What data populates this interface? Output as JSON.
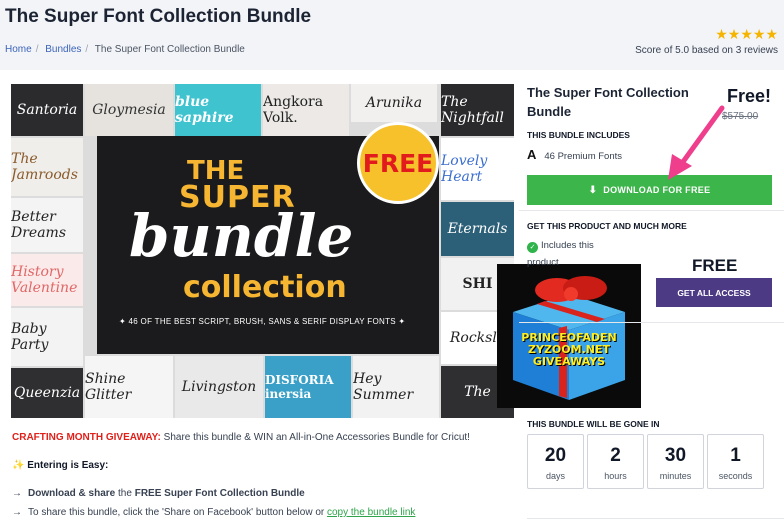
{
  "page": {
    "title": "The Super Font Collection Bundle",
    "breadcrumbs": [
      "Home",
      "Bundles",
      "The Super Font Collection Bundle"
    ],
    "rating": {
      "stars": 5,
      "score_text": "Score of 5.0 based on 3 reviews"
    }
  },
  "hero": {
    "free_badge": "FREE",
    "line_the": "THE",
    "line_super": "SUPER",
    "line_bundle": "bundle",
    "line_collection": "collection",
    "subtitle": "✦ 46 OF THE BEST SCRIPT, BRUSH, SANS & SERIF DISPLAY FONTS ✦",
    "tiles": [
      "Santoria",
      "Gloymesia",
      "blue saphire",
      "Angkora Volk.",
      "Arunika",
      "The Nightfall",
      "The Jamroods",
      "Lovely Heart",
      "Better Dreams",
      "Eternals",
      "History Valentine",
      "SHI",
      "Baby Party",
      "Rocksle",
      "Queenzia",
      "Shine Glitter",
      "Livingston",
      "DISFORIA inersia",
      "Hey Summer",
      "The"
    ],
    "overlay_text": [
      "PRINCEOFADEN",
      "ZYZOOM.NET",
      "GIVEAWAYS"
    ]
  },
  "body": {
    "promo_label": "CRAFTING MONTH GIVEAWAY:",
    "promo_text": " Share this bundle & WIN an All-in-One Accessories Bundle for Cricut!",
    "easy_label": "Entering is Easy:",
    "step1_bold": "Download & share",
    "step1_mid": " the ",
    "step1_bold2": "FREE Super Font Collection Bundle",
    "step2_text": "To share this bundle, click the 'Share on Facebook' button below or ",
    "step2_link": "copy the bundle link"
  },
  "sidebar": {
    "title": "The Super Font Collection Bundle",
    "price_label": "Free!",
    "old_price": "$575.00",
    "includes_heading": "THIS BUNDLE INCLUDES",
    "font_glyph": "A",
    "fonts_count_text": "46 Premium Fonts",
    "download_button": "DOWNLOAD FOR FREE",
    "more_heading": "GET THIS PRODUCT AND MUCH MORE",
    "includes_this": "Includes this",
    "product_text": "product",
    "free_big": "FREE",
    "access_button": "GET ALL ACCESS",
    "gone_heading": "THIS BUNDLE WILL BE GONE IN",
    "countdown": [
      {
        "value": "20",
        "unit": "days"
      },
      {
        "value": "2",
        "unit": "hours"
      },
      {
        "value": "30",
        "unit": "minutes"
      },
      {
        "value": "1",
        "unit": "seconds"
      }
    ]
  },
  "colors": {
    "download_green": "#3cb54a",
    "access_purple": "#4d3a84",
    "promo_red": "#e0211b",
    "badge_yellow": "#f6c12b",
    "arrow_pink": "#ee3e8c"
  },
  "icons": {
    "download": "download-icon",
    "check": "check-circle-icon",
    "rating": "star-icon",
    "step": "arrow-right-icon",
    "sparkle": "sparkles-icon"
  }
}
